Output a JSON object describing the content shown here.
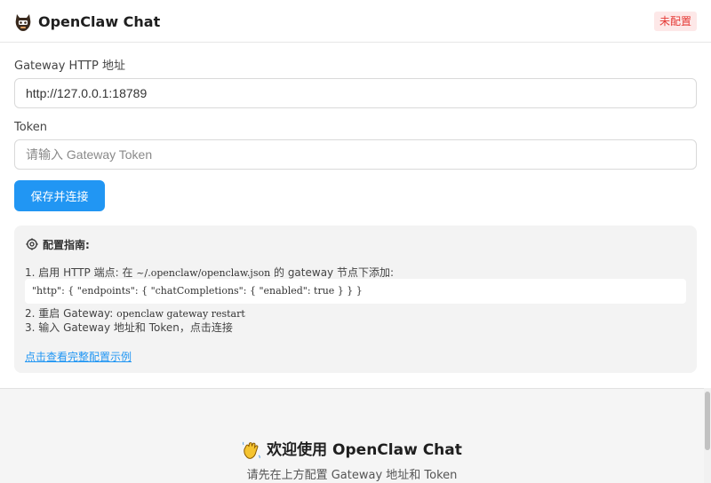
{
  "header": {
    "title": "OpenClaw Chat",
    "status": "未配置",
    "status_color": "#e53935",
    "logo_icon": "robot-icon"
  },
  "form": {
    "gateway_label": "Gateway HTTP 地址",
    "gateway_value": "http://127.0.0.1:18789",
    "token_label": "Token",
    "token_placeholder": "请输入 Gateway Token",
    "submit_label": "保存并连接"
  },
  "guide": {
    "icon": "gear-icon",
    "title": "配置指南:",
    "step1_text": "1. 启用 HTTP 端点: 在 ",
    "step1_path": "~/.openclaw/openclaw.json",
    "step1_suffix": " 的 gateway 节点下添加:",
    "code": "\"http\": { \"endpoints\": { \"chatCompletions\": { \"enabled\": true } } }",
    "step2_text": "2. 重启 Gateway: ",
    "step2_cmd": "openclaw gateway restart",
    "step3_text": "3. 输入 Gateway 地址和 Token，点击连接",
    "link": "点击查看完整配置示例"
  },
  "welcome": {
    "icon": "waving-hand-icon",
    "title": "欢迎使用 OpenClaw Chat",
    "subtitle": "请先在上方配置 Gateway 地址和 Token"
  },
  "colors": {
    "accent": "#2196f3",
    "badge_bg": "#fde8e8"
  }
}
